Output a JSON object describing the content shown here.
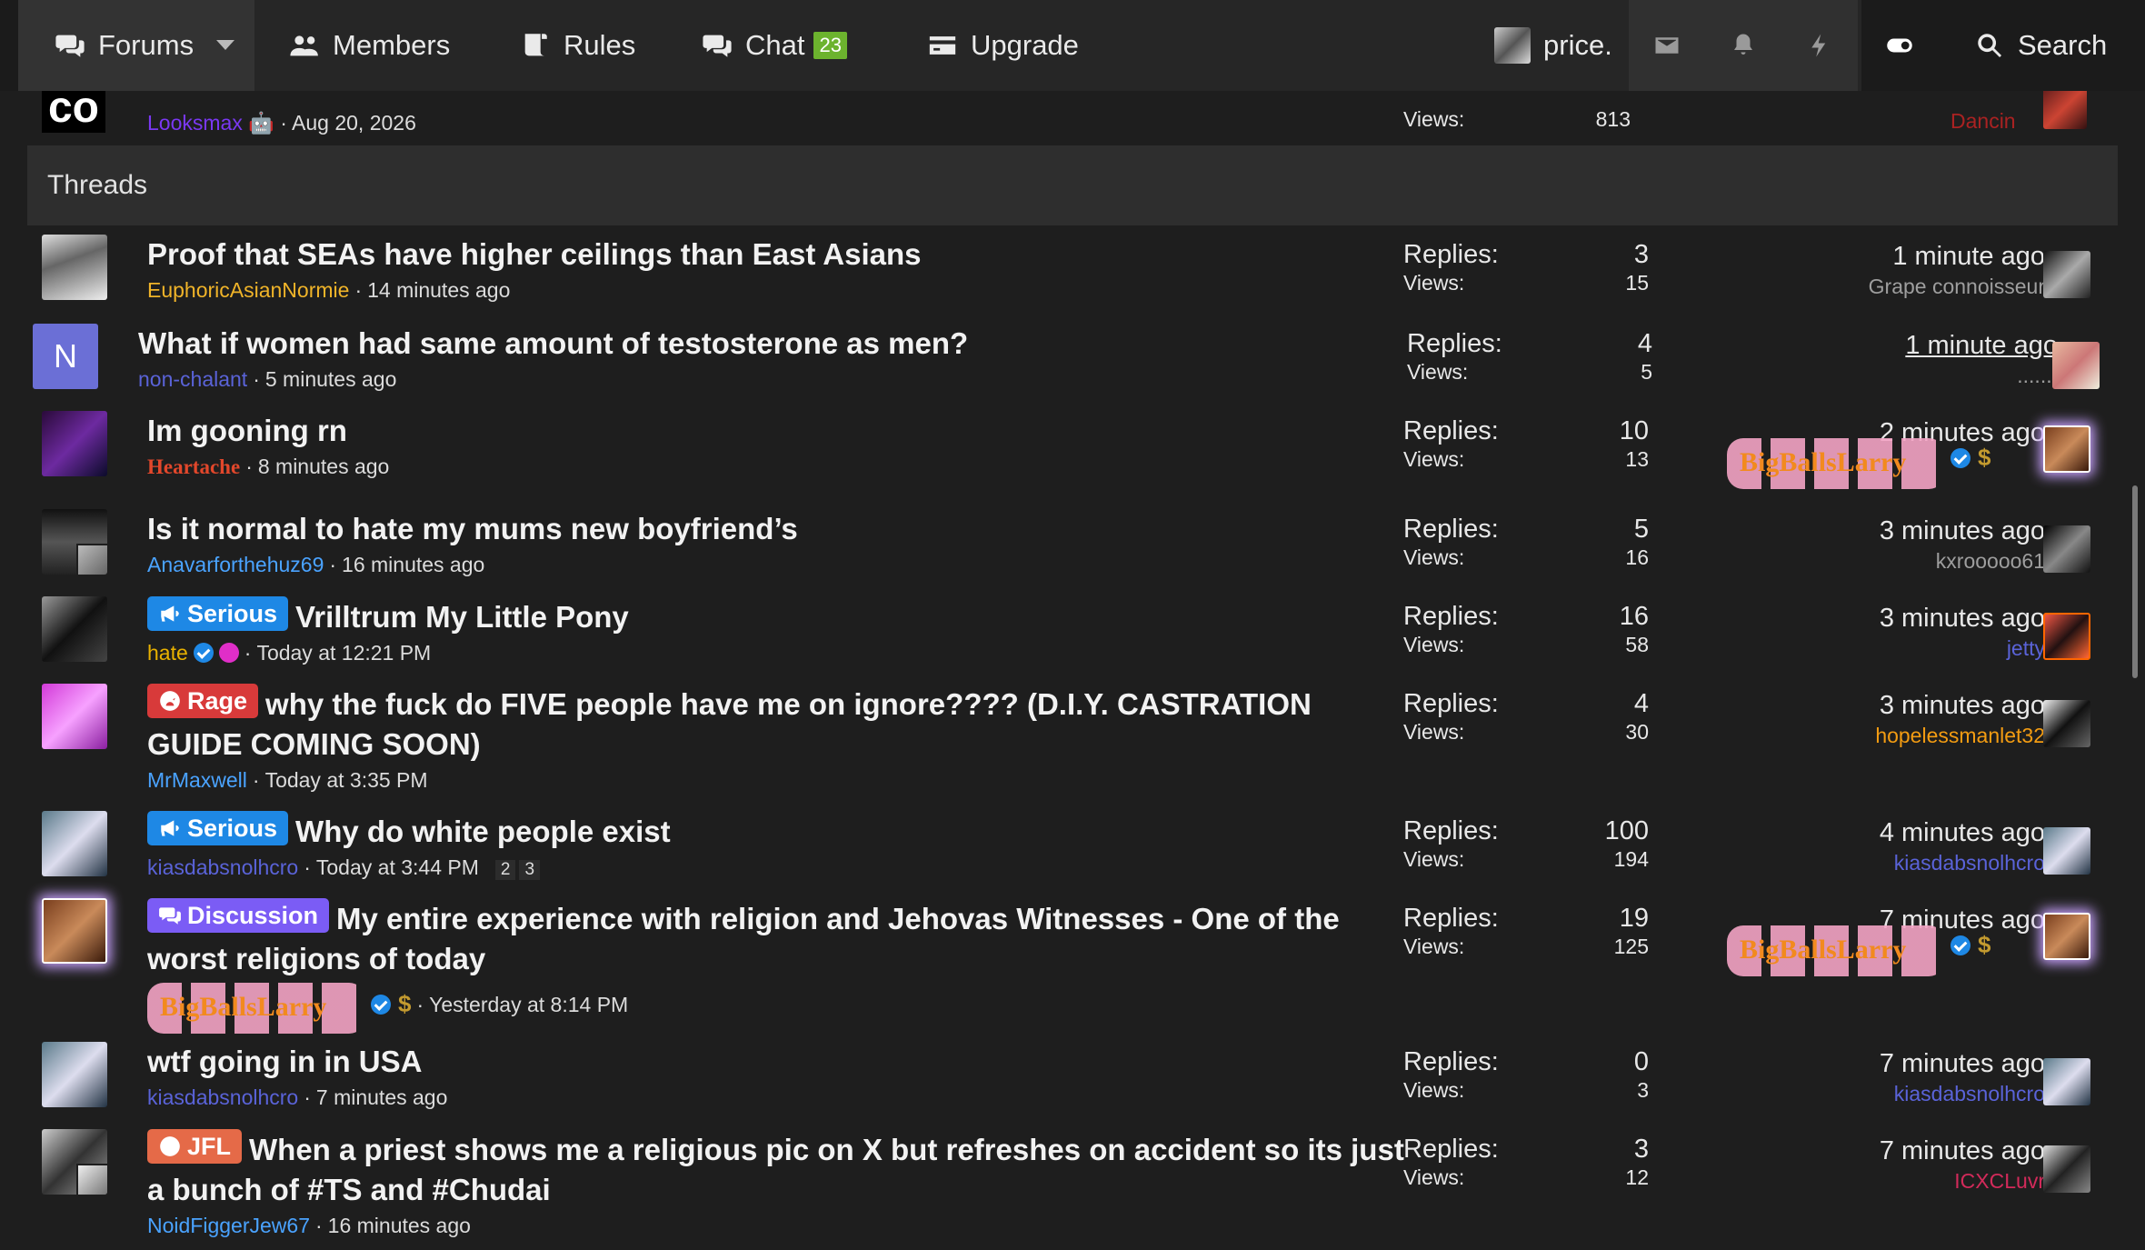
{
  "nav": {
    "forums": "Forums",
    "members": "Members",
    "rules": "Rules",
    "chat": "Chat",
    "chat_count": "23",
    "upgrade": "Upgrade",
    "username": "price.",
    "search": "Search"
  },
  "sticky": {
    "logo": "co",
    "author": "Looksmax",
    "date": "Aug 20, 2026",
    "views_label": "Views:",
    "views": "813",
    "last_user": "Dancin"
  },
  "section_title": "Threads",
  "labels": {
    "replies": "Replies:",
    "views": "Views:"
  },
  "threads": [
    {
      "title": "Proof that SEAs have higher ceilings than East Asians",
      "author": "EuphoricAsianNormie",
      "started": "14 minutes ago",
      "replies": "3",
      "views": "15",
      "last_time": "1 minute ago",
      "last_user": "Grape connoisseur"
    },
    {
      "title": "What if women had same amount of testosterone as men?",
      "author": "non-chalant",
      "avatar_letter": "N",
      "started": "5 minutes ago",
      "replies": "4",
      "views": "5",
      "last_time": "1 minute ago",
      "last_user": "......."
    },
    {
      "title": "Im gooning rn",
      "author": "Heartache",
      "started": "8 minutes ago",
      "replies": "10",
      "views": "13",
      "last_time": "2 minutes ago",
      "last_user": "BigBallsLarry"
    },
    {
      "title": "Is it normal to hate my mums new boyfriend’s",
      "author": "Anavarforthehuz69",
      "started": "16 minutes ago",
      "replies": "5",
      "views": "16",
      "last_time": "3 minutes ago",
      "last_user": "kxrooooo61"
    },
    {
      "prefix": "Serious",
      "title": "Vrilltrum My Little Pony",
      "author": "hate",
      "started": "Today at 12:21 PM",
      "replies": "16",
      "views": "58",
      "last_time": "3 minutes ago",
      "last_user": "jetty"
    },
    {
      "prefix": "Rage",
      "title": "why the fuck do FIVE people have me on ignore???? (D.I.Y. CASTRATION GUIDE COMING SOON)",
      "author": "MrMaxwell",
      "started": "Today at 3:35 PM",
      "replies": "4",
      "views": "30",
      "last_time": "3 minutes ago",
      "last_user": "hopelessmanlet32"
    },
    {
      "prefix": "Serious",
      "title": "Why do white people exist",
      "author": "kiasdabsnolhcro",
      "started": "Today at 3:44 PM",
      "pages": [
        "2",
        "3"
      ],
      "replies": "100",
      "views": "194",
      "last_time": "4 minutes ago",
      "last_user": "kiasdabsnolhcro"
    },
    {
      "prefix": "Discussion",
      "title": "My entire experience with religion and Jehovas Witnesses - One of the worst religions of today",
      "author": "BigBallsLarry",
      "started": "Yesterday at 8:14 PM",
      "replies": "19",
      "views": "125",
      "last_time": "7 minutes ago",
      "last_user": "BigBallsLarry"
    },
    {
      "title": "wtf going in in USA",
      "author": "kiasdabsnolhcro",
      "started": "7 minutes ago",
      "replies": "0",
      "views": "3",
      "last_time": "7 minutes ago",
      "last_user": "kiasdabsnolhcro"
    },
    {
      "prefix": "JFL",
      "title": "When a priest shows me a religious pic on X but refreshes on accident so its just a bunch of #TS and #Chudai",
      "author": "NoidFiggerJew67",
      "started": "16 minutes ago",
      "replies": "3",
      "views": "12",
      "last_time": "7 minutes ago",
      "last_user": "ICXCLuvr"
    }
  ],
  "colors": {
    "background": "#1e1e1e",
    "nav": "#262626",
    "serious": "#1e88e5",
    "rage": "#d83a3a",
    "discussion": "#7b5cf5",
    "jfl": "#e56a48",
    "chat_badge": "#6cb32e"
  }
}
